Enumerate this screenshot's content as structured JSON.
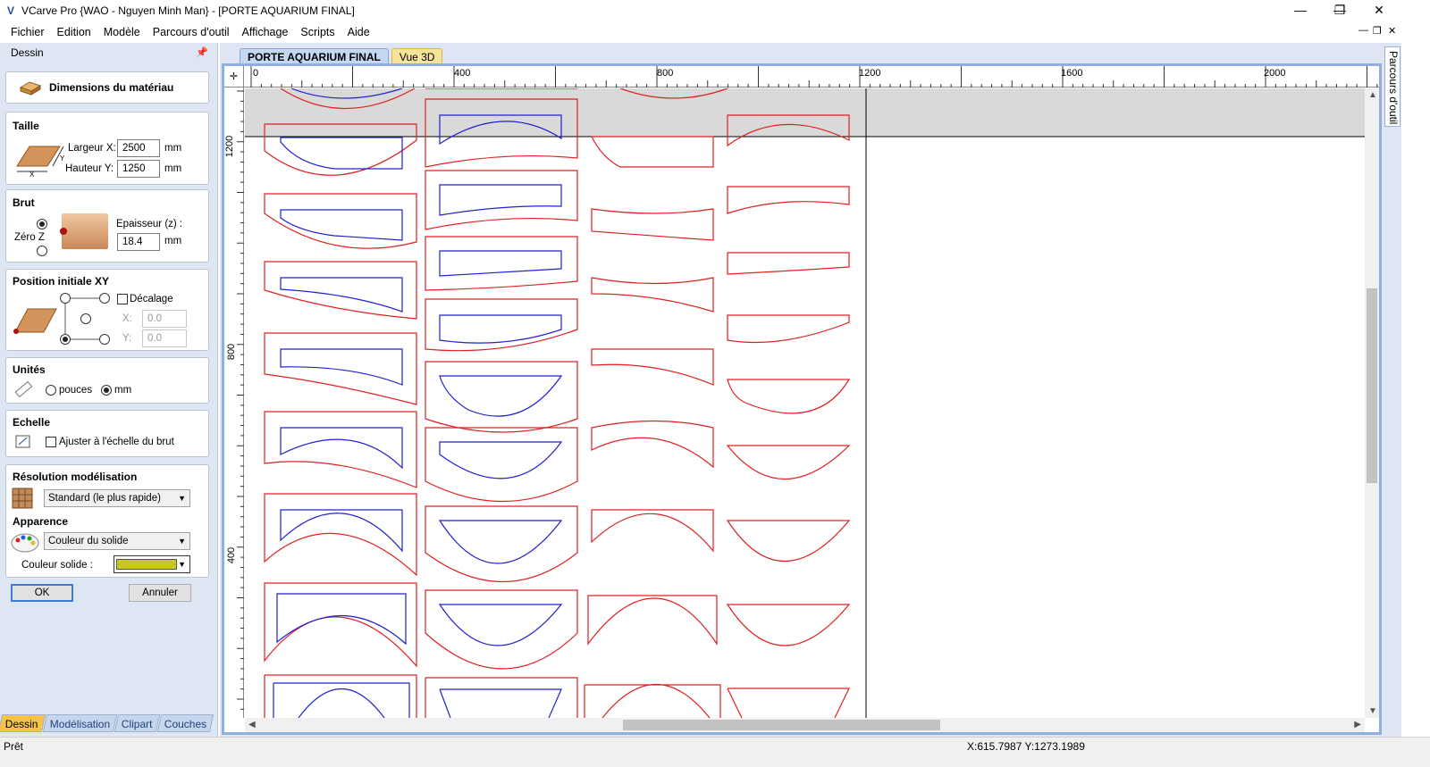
{
  "window": {
    "title": "VCarve Pro {WAO - Nguyen Minh Man} - [PORTE AQUARIUM FINAL]",
    "minimize": "—",
    "maximize": "❐",
    "close": "✕"
  },
  "menu": [
    "Fichier",
    "Edition",
    "Modèle",
    "Parcours d'outil",
    "Affichage",
    "Scripts",
    "Aide"
  ],
  "panel": {
    "header": "Dessin",
    "heading_button": "Dimensions du matériau",
    "taille": {
      "title": "Taille",
      "largeur_label": "Largeur X:",
      "largeur_value": "2500",
      "hauteur_label": "Hauteur Y:",
      "hauteur_value": "1250",
      "unit": "mm",
      "axis_x": "X",
      "axis_y": "Y"
    },
    "brut": {
      "title": "Brut",
      "zero_z": "Zéro Z",
      "epaisseur_label": "Epaisseur (z) :",
      "epaisseur_value": "18.4",
      "unit": "mm"
    },
    "position": {
      "title": "Position initiale XY",
      "decalage": "Décalage",
      "x_label": "X:",
      "x_value": "0.0",
      "y_label": "Y:",
      "y_value": "0.0"
    },
    "unites": {
      "title": "Unités",
      "pouces": "pouces",
      "mm": "mm"
    },
    "echelle": {
      "title": "Echelle",
      "ajuster": "Ajuster à l'échelle du brut"
    },
    "resolution": {
      "title": "Résolution modélisation",
      "value": "Standard (le plus rapide)"
    },
    "apparence": {
      "title": "Apparence",
      "value": "Couleur du solide",
      "couleur_label": "Couleur solide :",
      "couleur_hex": "#c8c820"
    },
    "ok": "OK",
    "annuler": "Annuler",
    "bottom_tabs": [
      "Dessin",
      "Modélisation",
      "Clipart",
      "Couches"
    ]
  },
  "document": {
    "tabs": [
      "PORTE AQUARIUM FINAL",
      "Vue 3D"
    ],
    "ruler_top_labels": [
      "0",
      "400",
      "800",
      "1200",
      "1600",
      "2000"
    ],
    "ruler_left_labels": [
      "1200",
      "800",
      "400"
    ]
  },
  "right_tab": "Parcours d'outil",
  "status": {
    "left": "Prêt",
    "coords": "X:615.7987 Y:1273.1989"
  },
  "colors": {
    "vector_red": "#e02020",
    "vector_blue": "#2020d0",
    "panel_bg": "#dde6f2",
    "accent_orange": "#f6c348"
  }
}
